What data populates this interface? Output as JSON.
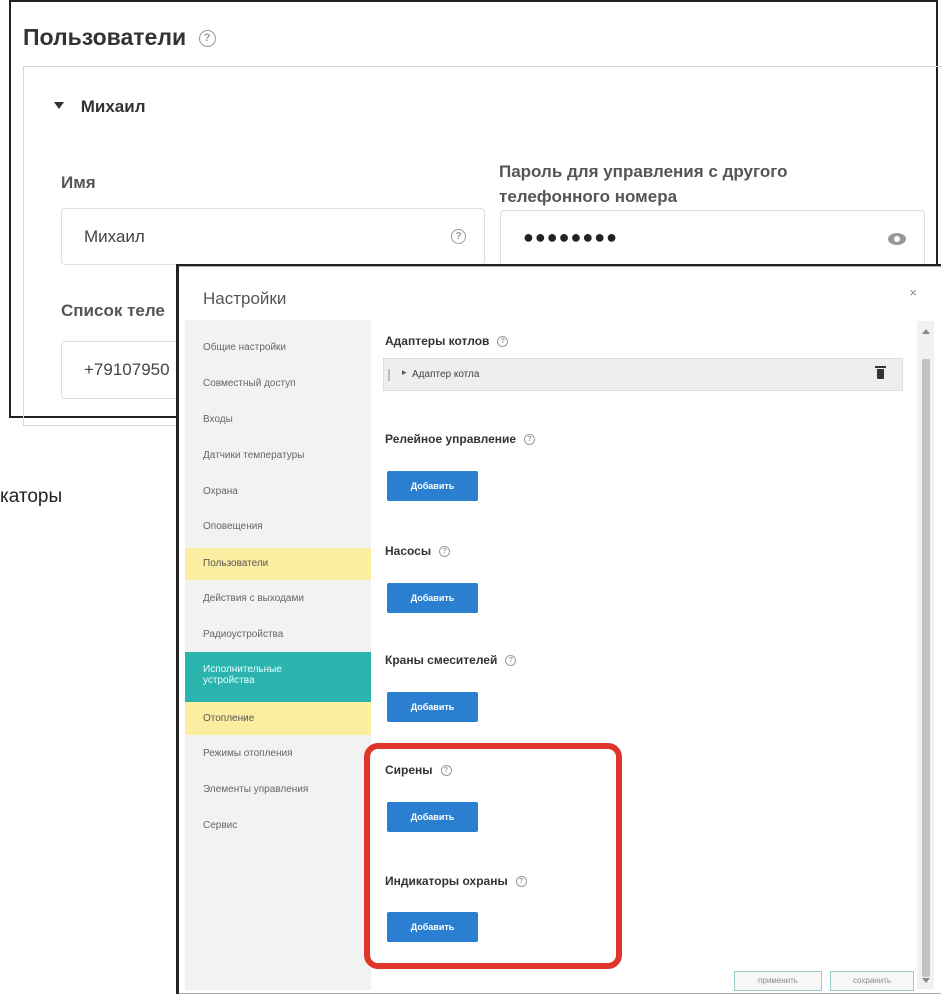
{
  "background_panel": {
    "title": "Пользователи",
    "help": "?",
    "user": {
      "name_header": "Михаил",
      "name_label": "Имя",
      "name_value": "Михаил",
      "name_help": "?",
      "password_label_line1": "Пароль для управления с другого",
      "password_label_line2": "телефонного номера",
      "password_value": "●●●●●●●●",
      "phones_label": "Список теле",
      "phone_value": "+79107950"
    }
  },
  "partial_left_text": "каторы",
  "dialog": {
    "title": "Настройки",
    "close": "×",
    "sidebar": [
      {
        "label": "Общие настройки",
        "state": "normal"
      },
      {
        "label": "Совместный доступ",
        "state": "normal"
      },
      {
        "label": "Входы",
        "state": "normal"
      },
      {
        "label": "Датчики температуры",
        "state": "normal"
      },
      {
        "label": "Охрана",
        "state": "normal"
      },
      {
        "label": "Оповещения",
        "state": "normal"
      },
      {
        "label": "Пользователи",
        "state": "yellow"
      },
      {
        "label": "Действия с выходами",
        "state": "normal"
      },
      {
        "label": "Радиоустройства",
        "state": "normal"
      },
      {
        "label": "Исполнительные устройства",
        "state": "teal"
      },
      {
        "label": "Отопление",
        "state": "yellow"
      },
      {
        "label": "Режимы отопления",
        "state": "normal"
      },
      {
        "label": "Элементы управления",
        "state": "normal"
      },
      {
        "label": "Сервис",
        "state": "normal"
      }
    ],
    "sections": {
      "adapters_title": "Адаптеры котлов",
      "adapter_item": "Адаптер котла",
      "relay_title": "Релейное управление",
      "pumps_title": "Насосы",
      "valves_title": "Краны смесителей",
      "sirens_title": "Сирены",
      "indicators_title": "Индикаторы охраны",
      "add_label": "Добавить",
      "help": "?"
    },
    "footer": {
      "apply": "применить",
      "save": "сохранить"
    },
    "colors": {
      "add_button": "#2b7fd0",
      "highlight_border": "#e0352d",
      "teal_item": "#2bb3ae",
      "yellow_item": "#fbeea0"
    }
  }
}
